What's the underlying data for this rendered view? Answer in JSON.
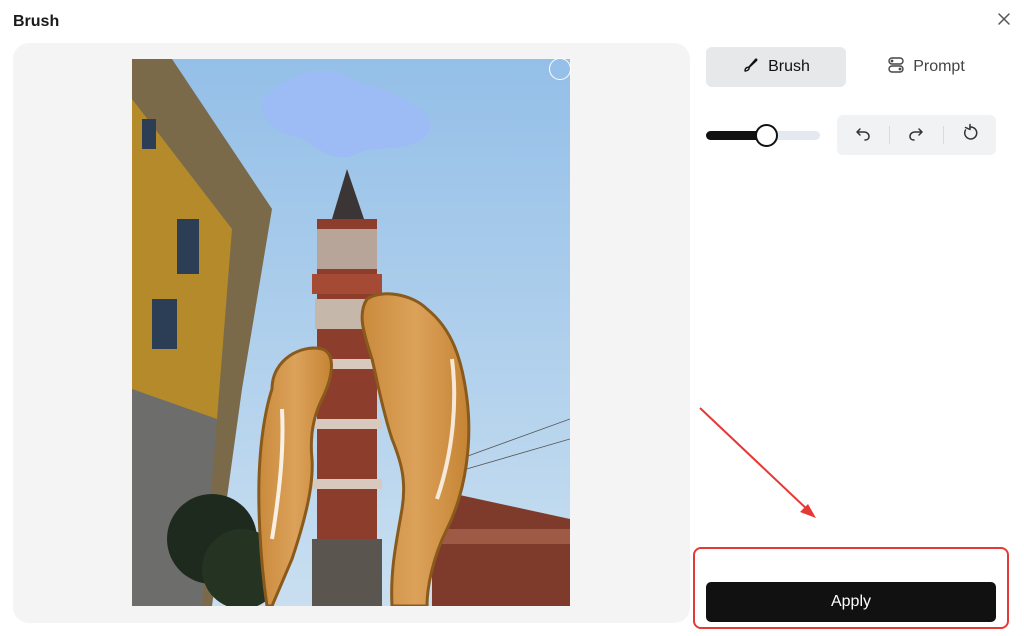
{
  "dialog": {
    "title": "Brush"
  },
  "tabs": [
    {
      "label": "Brush",
      "icon": "brush-icon",
      "active": true
    },
    {
      "label": "Prompt",
      "icon": "prompt-icon",
      "active": false
    }
  ],
  "brush_size": {
    "level": 0.53
  },
  "toolbar": {
    "undo_icon": "undo-icon",
    "redo_icon": "redo-icon",
    "reset_icon": "reset-icon"
  },
  "apply_button": {
    "label": "Apply"
  },
  "annotation": {
    "highlight_color": "#e53935"
  }
}
